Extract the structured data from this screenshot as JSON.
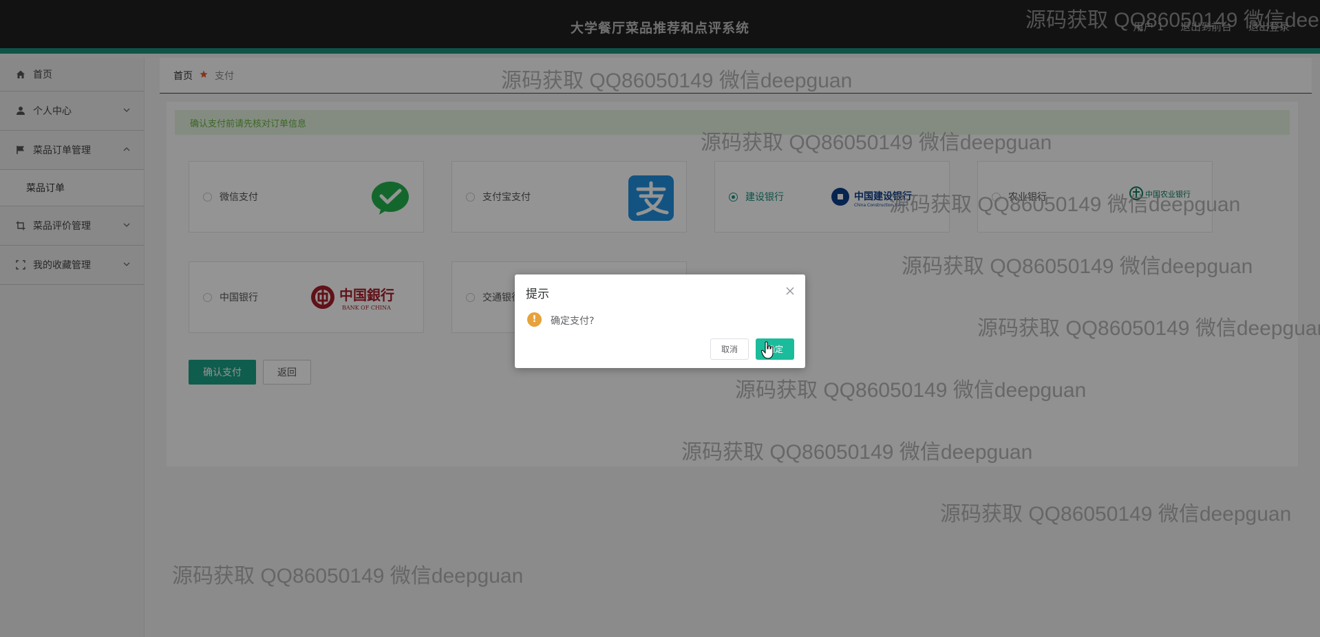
{
  "header": {
    "app_title": "大学餐厅菜品推荐和点评系统",
    "links": [
      "用户 1",
      "退出到前台",
      "退出登录"
    ]
  },
  "sidebar": {
    "items": [
      {
        "label": "首页",
        "icon": "home-icon"
      },
      {
        "label": "个人中心",
        "icon": "user-icon"
      },
      {
        "label": "菜品订单管理",
        "icon": "flag-icon"
      },
      {
        "label": "菜品订单",
        "icon": ""
      },
      {
        "label": "菜品评价管理",
        "icon": "crop-icon"
      },
      {
        "label": "我的收藏管理",
        "icon": "scan-icon"
      }
    ]
  },
  "breadcrumb": {
    "home": "首页",
    "current": "支付"
  },
  "content": {
    "tip": "确认支付前请先核对订单信息",
    "payment_methods": [
      {
        "label": "微信支付",
        "logo": "wechat-logo",
        "selected": false
      },
      {
        "label": "支付宝支付",
        "logo": "alipay-logo",
        "selected": false
      },
      {
        "label": "建设银行",
        "logo": "ccb-logo",
        "selected": true
      },
      {
        "label": "农业银行",
        "logo": "abc-logo",
        "selected": false
      },
      {
        "label": "中国银行",
        "logo": "boc-logo",
        "selected": false
      },
      {
        "label": "交通银行",
        "logo": "bocom-logo",
        "selected": false
      }
    ],
    "logo_text": {
      "ccb": "中国建设银行",
      "ccb_en": "China Construction Bank",
      "abc": "中国农业银行",
      "boc": "中国銀行",
      "boc_en": "BANK OF CHINA"
    },
    "confirm_button": "确认支付",
    "back_button": "返回"
  },
  "dialog": {
    "title": "提示",
    "message": "确定支付?",
    "cancel": "取消",
    "ok": "确定"
  },
  "watermark": "源码获取 QQ86050149 微信deepguan",
  "colors": {
    "header_bg": "#1f1f1f",
    "accent": "#1a8f7f",
    "primary_button": "#1aa085",
    "dialog_ok": "#1abc9c",
    "warning": "#e6a23c"
  }
}
